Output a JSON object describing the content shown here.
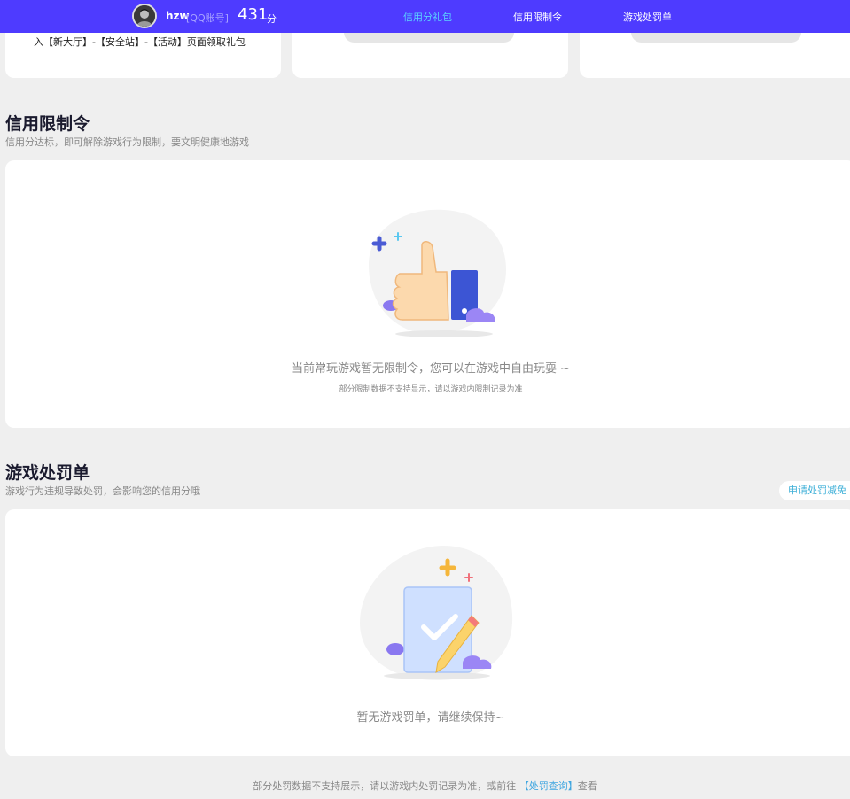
{
  "header": {
    "username": "hzw",
    "account_type": "[QQ账号]",
    "score": "431",
    "score_unit": "分",
    "nav": [
      {
        "label": "信用分礼包",
        "active": true
      },
      {
        "label": "信用限制令",
        "active": false
      },
      {
        "label": "游戏处罚单",
        "active": false
      }
    ]
  },
  "top_cards": {
    "card1_text": "入【新大厅】-【安全站】-【活动】页面领取礼包"
  },
  "restriction": {
    "title": "信用限制令",
    "subtitle": "信用分达标，即可解除游戏行为限制，要文明健康地游戏",
    "empty_main": "当前常玩游戏暂无限制令，您可以在游戏中自由玩耍 ~",
    "empty_sub": "部分限制数据不支持显示，请以游戏内限制记录为准"
  },
  "penalty": {
    "title": "游戏处罚单",
    "subtitle": "游戏行为违规导致处罚，会影响您的信用分哦",
    "appeal_button": "申请处罚减免",
    "empty_main": "暂无游戏罚单，请继续保持~"
  },
  "footer": {
    "text_before": "部分处罚数据不支持展示，请以游戏内处罚记录为准，或前往",
    "link": "【处罚查询】",
    "text_after": "查看"
  },
  "colors": {
    "topbar": "#4e3bff",
    "active_nav": "#5bd2ff",
    "link": "#3fa6e0"
  }
}
